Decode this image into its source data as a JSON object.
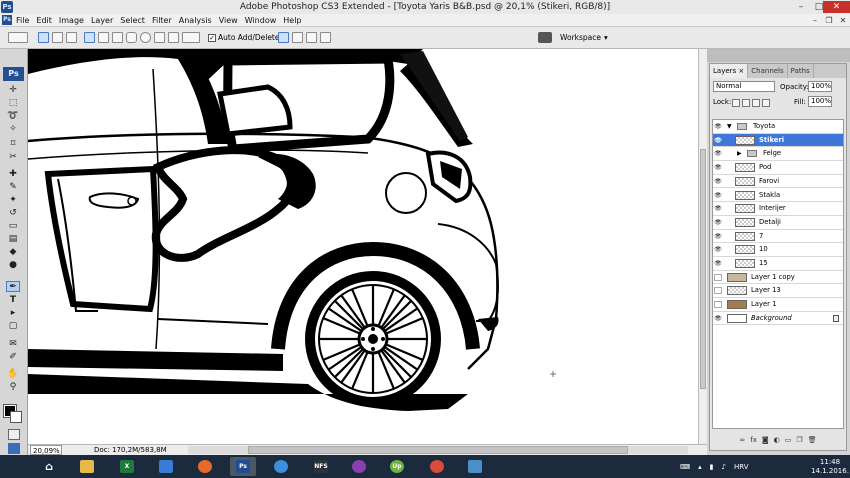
{
  "window": {
    "title": "Adobe Photoshop CS3 Extended - [Toyota Yaris B&B.psd @ 20,1% (Stikeri, RGB/8)]",
    "app_badge": "Ps",
    "controls": {
      "minimize": "–",
      "maximize": "□",
      "close": "✕"
    }
  },
  "menubar": {
    "items": [
      "File",
      "Edit",
      "Image",
      "Layer",
      "Select",
      "Filter",
      "Analysis",
      "View",
      "Window",
      "Help"
    ],
    "doc_controls": {
      "minimize": "–",
      "restore": "❐",
      "close": "✕"
    }
  },
  "options_bar": {
    "auto_add_delete_label": "Auto Add/Delete",
    "auto_add_delete_checked": "✓",
    "workspace_label": "Workspace",
    "workspace_arrow": "▾"
  },
  "tools_panel": {
    "badge": "Ps",
    "tools": [
      {
        "name": "move-tool",
        "glyph": "✛"
      },
      {
        "name": "marquee-tool",
        "glyph": "⬚"
      },
      {
        "name": "lasso-tool",
        "glyph": "➰"
      },
      {
        "name": "magic-wand-tool",
        "glyph": "✧"
      },
      {
        "name": "crop-tool",
        "glyph": "⌑"
      },
      {
        "name": "slice-tool",
        "glyph": "✂"
      },
      {
        "name": "healing-brush-tool",
        "glyph": "✚"
      },
      {
        "name": "brush-tool",
        "glyph": "✎"
      },
      {
        "name": "clone-stamp-tool",
        "glyph": "✦"
      },
      {
        "name": "history-brush-tool",
        "glyph": "↺"
      },
      {
        "name": "eraser-tool",
        "glyph": "▭"
      },
      {
        "name": "gradient-tool",
        "glyph": "▤"
      },
      {
        "name": "blur-tool",
        "glyph": "◆"
      },
      {
        "name": "dodge-tool",
        "glyph": "●"
      },
      {
        "name": "pen-tool",
        "glyph": "✒"
      },
      {
        "name": "type-tool",
        "glyph": "T"
      },
      {
        "name": "path-selection-tool",
        "glyph": "▸"
      },
      {
        "name": "shape-tool",
        "glyph": "▢"
      },
      {
        "name": "notes-tool",
        "glyph": "✉"
      },
      {
        "name": "eyedropper-tool",
        "glyph": "✐"
      },
      {
        "name": "hand-tool",
        "glyph": "✋"
      },
      {
        "name": "zoom-tool",
        "glyph": "⚲"
      }
    ],
    "active_tool": "pen-tool"
  },
  "status_bar": {
    "zoom": "20,09%",
    "doc": "Doc: 170,2M/583,8M"
  },
  "layers_panel": {
    "tabs": [
      {
        "label": "Layers ×",
        "active": true
      },
      {
        "label": "Channels",
        "active": false
      },
      {
        "label": "Paths",
        "active": false
      }
    ],
    "blend_mode": "Normal",
    "opacity_label": "Opacity:",
    "opacity_value": "100%",
    "lock_label": "Lock:",
    "fill_label": "Fill:",
    "fill_value": "100%",
    "layers": [
      {
        "name": "Toyota",
        "kind": "group",
        "level": 0,
        "visible": true,
        "expanded": true
      },
      {
        "name": "Stikeri",
        "kind": "layer",
        "level": 1,
        "visible": true,
        "selected": true
      },
      {
        "name": "Felge",
        "kind": "group",
        "level": 1,
        "visible": true,
        "expanded": false
      },
      {
        "name": "Pod",
        "kind": "layer",
        "level": 1,
        "visible": true
      },
      {
        "name": "Farovi",
        "kind": "layer",
        "level": 1,
        "visible": true
      },
      {
        "name": "Stakla",
        "kind": "layer",
        "level": 1,
        "visible": true
      },
      {
        "name": "Interijer",
        "kind": "layer",
        "level": 1,
        "visible": true
      },
      {
        "name": "Detalji",
        "kind": "layer",
        "level": 1,
        "visible": true
      },
      {
        "name": "7",
        "kind": "layer",
        "level": 1,
        "visible": true
      },
      {
        "name": "10",
        "kind": "layer",
        "level": 1,
        "visible": true
      },
      {
        "name": "15",
        "kind": "layer",
        "level": 1,
        "visible": true
      },
      {
        "name": "Layer 1 copy",
        "kind": "image",
        "level": 0,
        "visible": false
      },
      {
        "name": "Layer 13",
        "kind": "layer",
        "level": 0,
        "visible": false
      },
      {
        "name": "Layer 1",
        "kind": "image",
        "level": 0,
        "visible": false
      },
      {
        "name": "Background",
        "kind": "background",
        "level": 0,
        "visible": true,
        "locked": true
      }
    ],
    "bottom_icons": [
      "link-icon",
      "fx-icon",
      "mask-icon",
      "adjustment-icon",
      "folder-icon",
      "new-layer-icon",
      "trash-icon"
    ]
  },
  "taskbar": {
    "apps": [
      {
        "name": "start-button",
        "label": "",
        "color": "#1b2a3d"
      },
      {
        "name": "file-explorer",
        "label": "",
        "color": "#e8b84a"
      },
      {
        "name": "excel",
        "label": "X",
        "color": "#1f7a3f"
      },
      {
        "name": "computer",
        "label": "",
        "color": "#3a7bd5"
      },
      {
        "name": "firefox",
        "label": "",
        "color": "#e86a2a"
      },
      {
        "name": "photoshop",
        "label": "Ps",
        "color": "#1f4f8f"
      },
      {
        "name": "app-7",
        "label": "",
        "color": "#3c8fd8"
      },
      {
        "name": "nfs",
        "label": "NFS",
        "color": "#2e3338"
      },
      {
        "name": "game-app",
        "label": "",
        "color": "#8a3fb0"
      },
      {
        "name": "upwork",
        "label": "Up",
        "color": "#6fb23a"
      },
      {
        "name": "chrome",
        "label": "",
        "color": "#d94b3a"
      },
      {
        "name": "image-viewer",
        "label": "",
        "color": "#4a90c8"
      }
    ],
    "tray_lang": "HRV",
    "time": "11:48",
    "date": "14.1.2016."
  }
}
